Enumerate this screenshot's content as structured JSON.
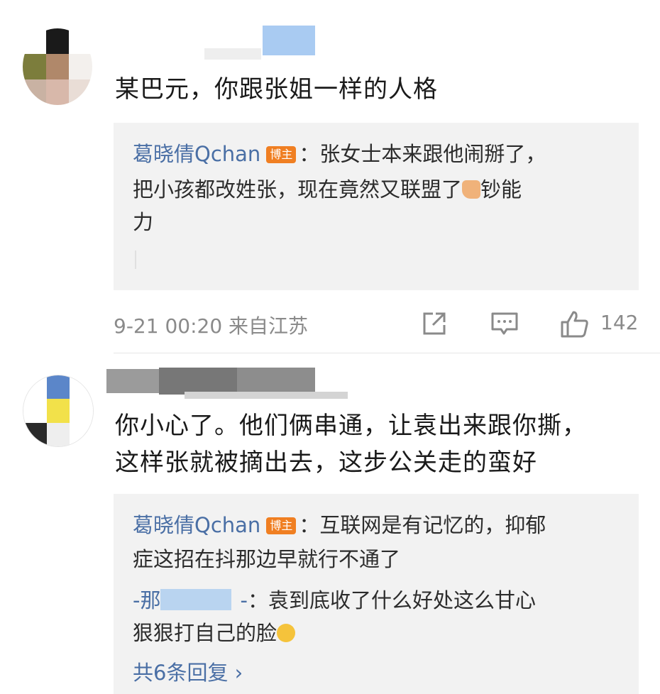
{
  "comments": [
    {
      "text": "某巴元，你跟张姐一样的人格",
      "reply": {
        "author": "葛晓倩Qchan",
        "badge": "博主",
        "line1": "：张女士本来跟他闹掰了，",
        "line2": "把小孩都改姓张，现在竟然又联盟了",
        "line2_tail": "钞能",
        "line3": "力",
        "emoji": "thumbs-up-icon"
      },
      "time": "9-21 00:20",
      "location": "来自江苏",
      "likes": "142"
    },
    {
      "text_line1": "你小心了。他们俩串通，让袁出来跟你撕，",
      "text_line2": "这样张就被摘出去，这步公关走的蛮好",
      "replies": [
        {
          "author": "葛晓倩Qchan",
          "badge": "博主",
          "line1": "：互联网是有记忆的，抑郁",
          "line2": "症这招在抖那边早就行不通了"
        },
        {
          "author_prefix": "-那",
          "author_suffix": "-",
          "line1": "：袁到底收了什么好处这么甘心",
          "line2": "狠狠打自己的脸",
          "emoji": "smile-icon"
        }
      ],
      "more_replies": "共6条回复 ›"
    }
  ],
  "colors": {
    "link": "#4a6fa5",
    "badge": "#f07f22",
    "reply_bg": "#f2f2f2",
    "meta": "#8a8a8a"
  }
}
